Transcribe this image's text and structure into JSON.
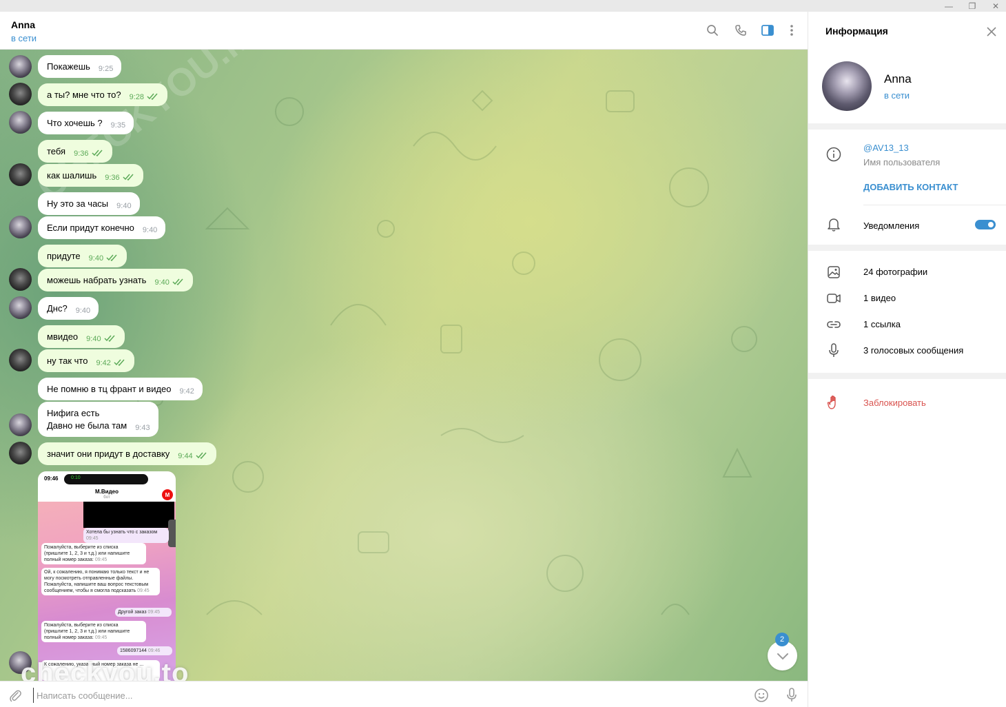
{
  "window": {
    "minimize_glyph": "—",
    "restore_glyph": "❐",
    "close_glyph": "✕"
  },
  "chat": {
    "name": "Anna",
    "status": "в сети",
    "header_icons": [
      "search-icon",
      "phone-icon",
      "sidebar-toggle-icon",
      "more-vert-icon"
    ]
  },
  "messages": [
    {
      "text": "Покажешь",
      "time": "9:25",
      "out": false
    },
    {
      "text": "а ты? мне что то?",
      "time": "9:28",
      "out": true
    },
    {
      "text": "Что хочешь ?",
      "time": "9:35",
      "out": false
    },
    {
      "text": "тебя",
      "time": "9:36",
      "out": true
    },
    {
      "text": "как шалишь",
      "time": "9:36",
      "out": true
    },
    {
      "text": "Ну это за часы",
      "time": "9:40",
      "out": false
    },
    {
      "text": "Если придут конечно",
      "time": "9:40",
      "out": false
    },
    {
      "text": "придуте",
      "time": "9:40",
      "out": true
    },
    {
      "text": "можешь набрать узнать",
      "time": "9:40",
      "out": true
    },
    {
      "text": "Днс?",
      "time": "9:40",
      "out": false
    },
    {
      "text": "мвидео",
      "time": "9:40",
      "out": true
    },
    {
      "text": "ну так что",
      "time": "9:42",
      "out": true
    },
    {
      "text": "Не помню в тц франт и видео",
      "time": "9:42",
      "out": false
    },
    {
      "text_line1": "Нифига есть",
      "text_line2": "Давно не была там",
      "time": "9:43",
      "out": false
    },
    {
      "text": "значит они придут в доставку",
      "time": "9:44",
      "out": true
    }
  ],
  "screenshot": {
    "phone_time": "09:46",
    "call_time": "0:10",
    "title": "М.Видео",
    "subtitle": "бот",
    "logo": "М",
    "bubbles": [
      {
        "text": "Хотела бы узнать что с заказом",
        "time": "09:45"
      },
      {
        "text": "Пожалуйста, выберите из списка (пришлите 1, 2, 3 и т.д.) или напишите полный номер заказа:",
        "time": "09:45"
      },
      {
        "text": "Ой, к сожалению, я понимаю только текст и не могу посмотреть отправленные файлы. Пожалуйста, напишите ваш вопрос текстовым сообщением, чтобы я смогла подсказать",
        "time": "09:45"
      },
      {
        "text": "Другой заказ",
        "time": "09:45"
      },
      {
        "text": "Пожалуйста, выберите из списка (пришлите 1, 2, 3 и т.д.) или напишите полный номер заказа:",
        "time": "09:45"
      },
      {
        "text": "1586097144",
        "time": "09:46"
      },
      {
        "text": "К сожалению, указанный номер заказа не ...",
        "time": ""
      }
    ]
  },
  "scroll_button": {
    "unread_count": "2"
  },
  "watermark": {
    "bottom": "checkyou.to",
    "diagonal": "CHECKYOU.ME"
  },
  "composer": {
    "placeholder": "Написать сообщение..."
  },
  "info_panel": {
    "title": "Информация",
    "name": "Anna",
    "status": "в сети",
    "username": "@AV13_13",
    "username_caption": "Имя пользователя",
    "add_contact": "ДОБАВИТЬ КОНТАКТ",
    "notifications_label": "Уведомления",
    "notifications_on": true,
    "media": [
      {
        "label": "24 фотографии",
        "icon": "photo-icon"
      },
      {
        "label": "1 видео",
        "icon": "video-icon"
      },
      {
        "label": "1 ссылка",
        "icon": "link-icon"
      },
      {
        "label": "3 голосовых сообщения",
        "icon": "microphone-icon"
      }
    ],
    "block_label": "Заблокировать"
  },
  "colors": {
    "accent": "#3a8fd0",
    "outgoing_bubble": "#effdde",
    "incoming_bubble": "#ffffff",
    "danger": "#d9534f",
    "read_ticks": "#5caa58"
  }
}
